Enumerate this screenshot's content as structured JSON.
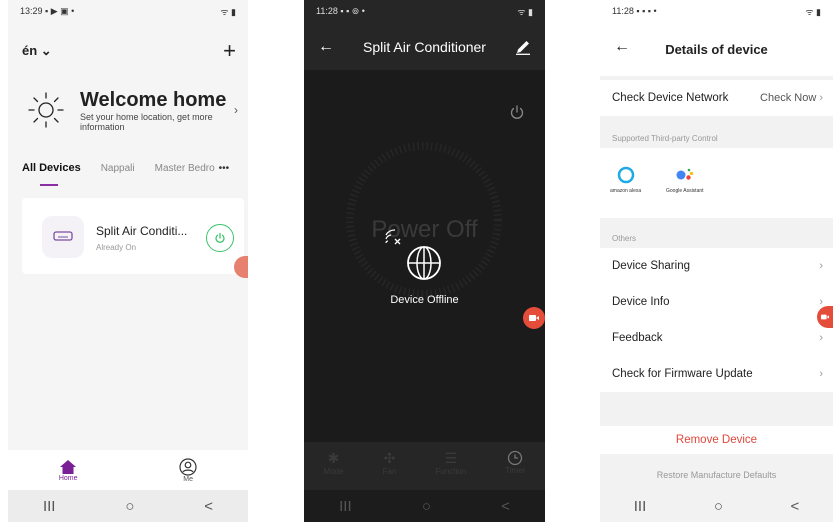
{
  "phone1": {
    "status_time": "13:29",
    "status_icons": "▪ ▶ ▣ •",
    "status_right": "ᯤ ▮",
    "home_name": "én",
    "welcome_title": "Welcome home",
    "welcome_sub": "Set your home location, get more information",
    "tabs": [
      "All Devices",
      "Nappali",
      "Master Bedro"
    ],
    "more": "•••",
    "device_name": "Split Air Conditi...",
    "device_status": "Already On",
    "tab_home": "Home",
    "tab_me": "Me"
  },
  "phone2": {
    "status_time": "11:28",
    "status_icons": "▪ ▪ ⊚ •",
    "status_right": "ᯤ ▮",
    "title": "Split Air Conditioner",
    "power_off": "Power Off",
    "offline": "Device Offline",
    "controls": [
      "Mode",
      "Fan",
      "Function",
      "Timer"
    ]
  },
  "phone3": {
    "status_time": "11:28",
    "status_icons": "▪ ▪ ▪ •",
    "status_right": "ᯤ ▮",
    "title": "Details of device",
    "check_network": "Check Device Network",
    "check_now": "Check Now",
    "third_party_label": "Supported Third-party Control",
    "alexa": "amazon alexa",
    "google": "Google Assistant",
    "others_label": "Others",
    "rows": [
      "Device Sharing",
      "Device Info",
      "Feedback",
      "Check for Firmware Update"
    ],
    "remove": "Remove Device",
    "restore": "Restore Manufacture Defaults"
  },
  "nav": {
    "recents": "III",
    "home": "○",
    "back": "<"
  },
  "colors": {
    "accent": "#8a2fa6",
    "power_green": "#3cc46a",
    "danger": "#e1483b"
  }
}
